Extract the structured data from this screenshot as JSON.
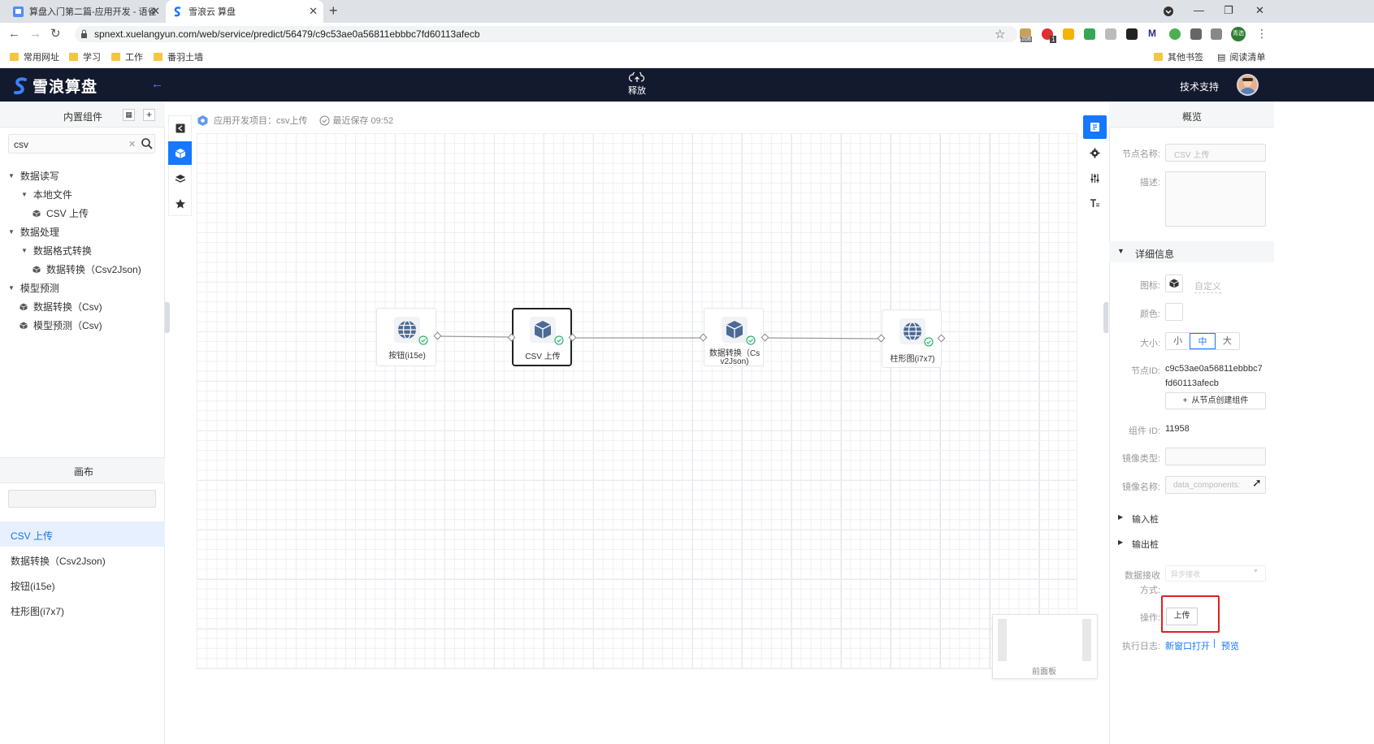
{
  "browser": {
    "tabs": [
      {
        "title": "算盘入门第二篇-应用开发 - 语雀"
      },
      {
        "title": "雪浪云 算盘"
      }
    ],
    "url": "spnext.xuelangyun.com/web/service/predict/56479/c9c53ae0a56811ebbbc7fd60113afecb",
    "ext_badges": {
      "badge1": "208",
      "badge2": "1",
      "profile": "青选"
    },
    "bookmarks": [
      "常用网址",
      "学习",
      "工作",
      "番羽土墙"
    ],
    "bookmarks_right": [
      "其他书签",
      "阅读清单"
    ]
  },
  "app": {
    "brand": "雪浪算盘",
    "release_label": "释放",
    "support_label": "技术支持",
    "accent_color": "#1677ff",
    "header_color": "#141a2e"
  },
  "left_panel": {
    "title": "内置组件",
    "search_value": "csv",
    "tree": [
      {
        "label": "数据读写"
      },
      {
        "label": "本地文件"
      },
      {
        "label": "CSV 上传"
      },
      {
        "label": "数据处理"
      },
      {
        "label": "数据格式转换"
      },
      {
        "label": "数据转换（Csv2Json)"
      },
      {
        "label": "模型预测"
      },
      {
        "label": "数据转换（Csv)"
      },
      {
        "label": "模型预测（Csv)"
      }
    ],
    "canvas_title": "画布",
    "canvas_items": [
      "CSV 上传",
      "数据转换（Csv2Json)",
      "按钮(i15e)",
      "柱形图(i7x7)"
    ]
  },
  "canvas": {
    "project_label": "应用开发项目：csv上传",
    "save_status": "最近保存 09:52",
    "nodes": [
      {
        "label": "按钮(i15e)",
        "icon": "globe-icon"
      },
      {
        "label": "CSV 上传",
        "icon": "cube-icon"
      },
      {
        "label": "数据转换（Cs",
        "label2": "v2Json)",
        "icon": "cube-icon"
      },
      {
        "label": "柱形图(i7x7)",
        "icon": "globe-icon"
      }
    ],
    "minimap_label": "前面板"
  },
  "right_panel": {
    "title": "概览",
    "node_name_label": "节点名称:",
    "node_name_value": "CSV 上传",
    "desc_label": "描述:",
    "detail_section": "详细信息",
    "icon_label": "图标:",
    "custom_label": "自定义",
    "color_label": "颜色:",
    "size_label": "大小:",
    "sizes": [
      "小",
      "中",
      "大"
    ],
    "selected_size": "中",
    "node_id_label": "节点ID:",
    "node_id_line1": "c9c53ae0a56811ebbbc7",
    "node_id_line2": "fd60113afecb",
    "create_from_node": "从节点创建组件",
    "component_id_label": "组件 ID:",
    "component_id_value": "11958",
    "image_type_label": "镜像类型:",
    "image_name_label": "镜像名称:",
    "image_name_value": "data_components:",
    "input_ports": "输入桩",
    "output_ports": "输出桩",
    "receive_label_1": "数据接收",
    "receive_label_2": "方式:",
    "receive_value": "异步接收",
    "operation_label": "操作:",
    "upload_button": "上传",
    "log_label": "执行日志:",
    "log_link_new": "新窗口打开",
    "log_link_preview": "预览"
  }
}
